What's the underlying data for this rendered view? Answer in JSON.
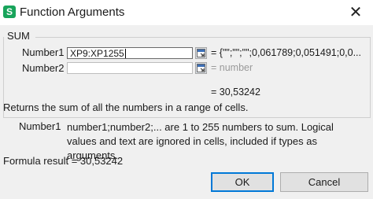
{
  "window": {
    "title": "Function Arguments",
    "icon": "S"
  },
  "function": {
    "name": "SUM"
  },
  "args": [
    {
      "label": "Number1",
      "value": "XP9:XP1255",
      "result": "= {\"\";\"\";\"\";0,061789;0,051491;0,0..."
    },
    {
      "label": "Number2",
      "value": "",
      "placeholder": "= number"
    }
  ],
  "function_result": "= 30,53242",
  "description": "Returns the sum of all the numbers in a range of cells.",
  "help": {
    "label": "Number1",
    "text": "number1;number2;... are 1 to 255 numbers to sum. Logical values and text are ignored in cells, included if types as arguments."
  },
  "formula_result": "Formula result =  30,53242",
  "buttons": {
    "ok": "OK",
    "cancel": "Cancel"
  }
}
